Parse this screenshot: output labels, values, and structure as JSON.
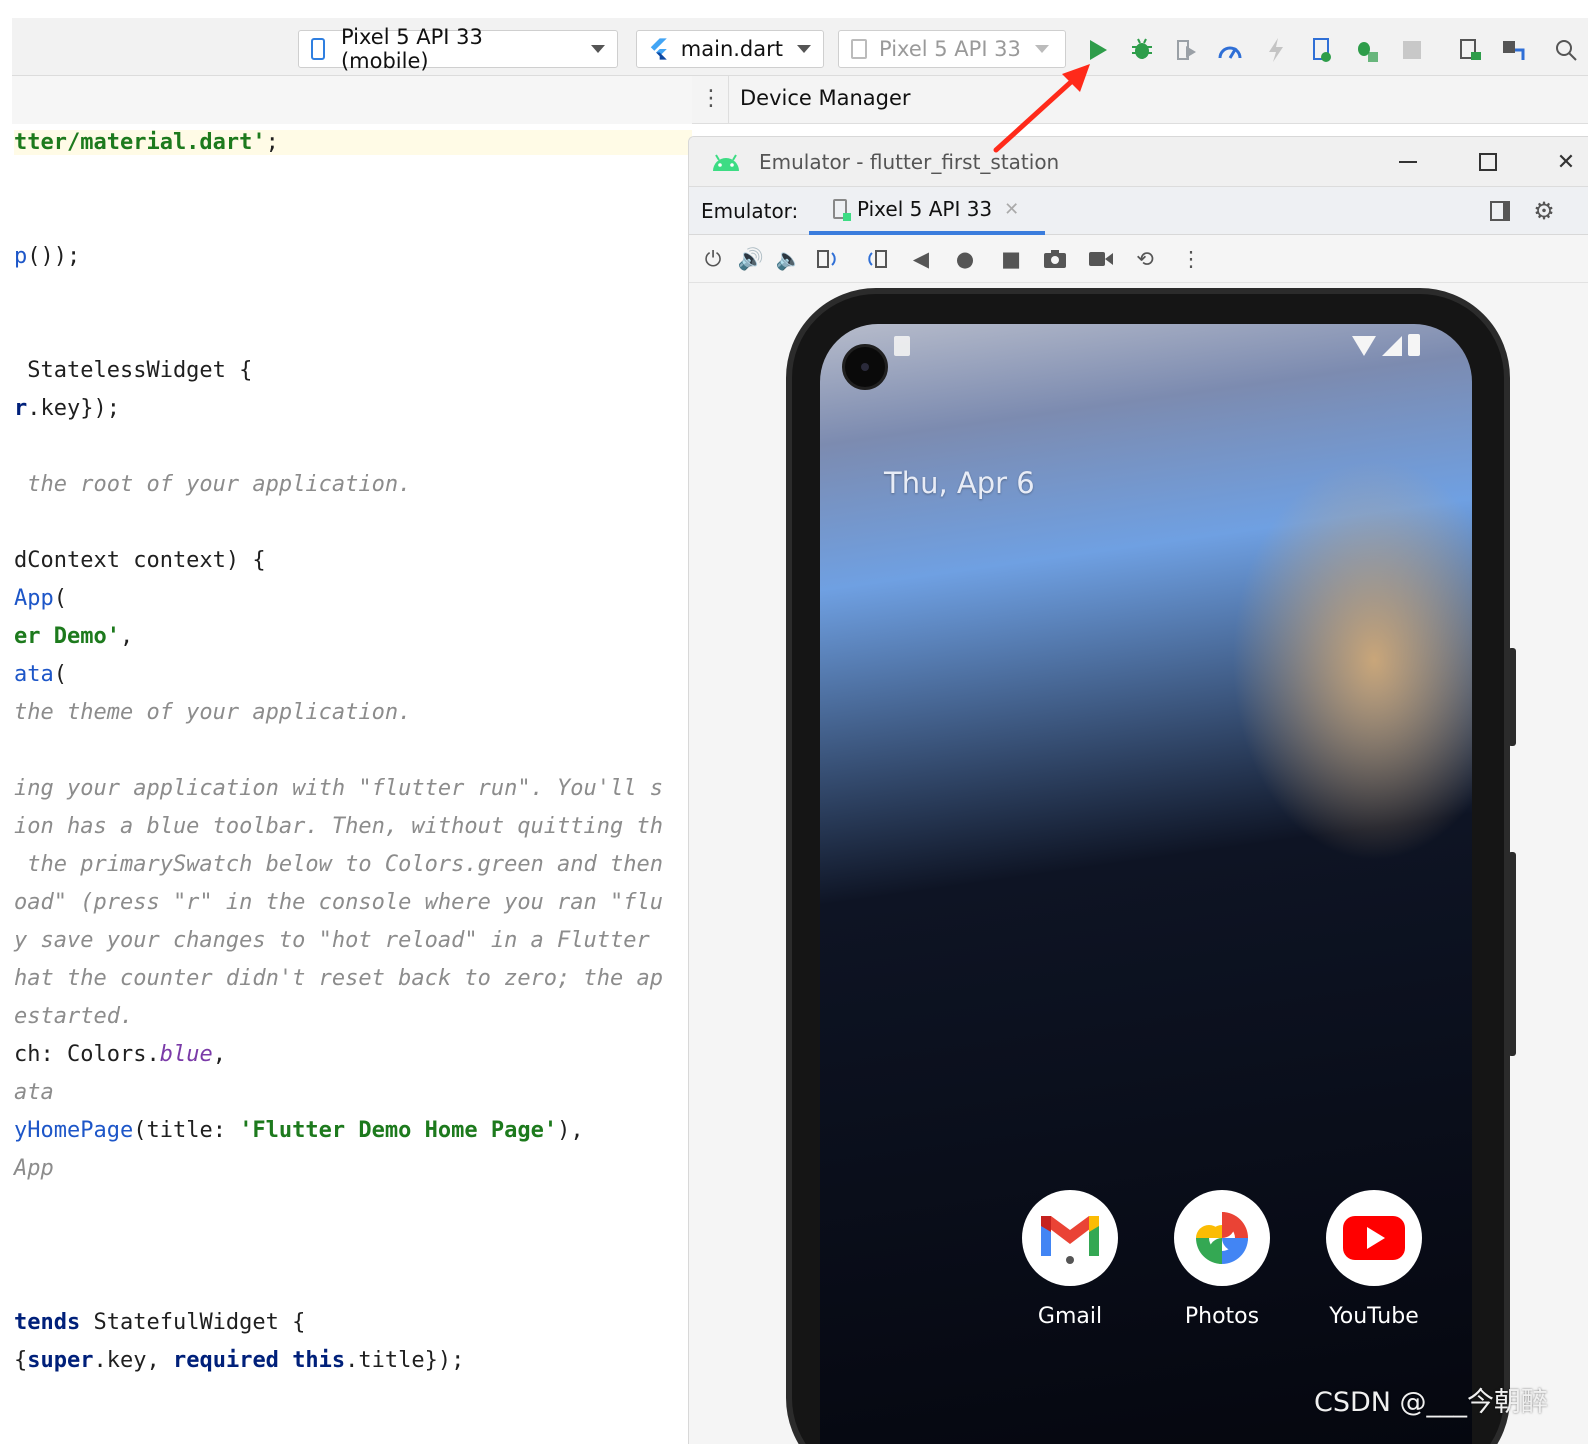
{
  "toolbar": {
    "device_selector": "Pixel 5 API 33 (mobile)",
    "run_config": "main.dart",
    "target_device": "Pixel 5 API 33",
    "icons": [
      "run-icon",
      "debug-icon",
      "run-with-coverage-icon",
      "profile-icon",
      "hot-reload-icon",
      "attach-debugger-icon",
      "debug-ext-icon",
      "stop-icon",
      "device-manager-icon",
      "sdk-manager-icon",
      "search-icon"
    ],
    "colors": {
      "run": "#2e9d4a",
      "debug": "#2e9d4a",
      "profile": "#2f6fd6"
    }
  },
  "tool_window": {
    "title": "Device Manager"
  },
  "editor": {
    "lines": [
      {
        "parts": [
          {
            "t": "tter/material.dart'",
            "c": "c-green"
          },
          {
            "t": ";",
            "c": ""
          }
        ],
        "highlight": true
      },
      {
        "parts": [
          {
            "t": "p",
            "c": "c-blue"
          },
          {
            "t": "());",
            "c": ""
          }
        ]
      },
      {
        "parts": [
          {
            "t": " StatelessWidget {",
            "c": ""
          }
        ]
      },
      {
        "parts": [
          {
            "t": "r",
            "c": "c-kw"
          },
          {
            "t": ".key});",
            "c": ""
          }
        ]
      },
      {
        "parts": [
          {
            "t": " the root of your application.",
            "c": "c-comment"
          }
        ]
      },
      {
        "parts": [
          {
            "t": "dContext context) {",
            "c": ""
          }
        ]
      },
      {
        "parts": [
          {
            "t": "App",
            "c": "c-blue"
          },
          {
            "t": "(",
            "c": ""
          }
        ]
      },
      {
        "parts": [
          {
            "t": "er Demo'",
            "c": "c-green"
          },
          {
            "t": ",",
            "c": ""
          }
        ]
      },
      {
        "parts": [
          {
            "t": "ata",
            "c": "c-blue"
          },
          {
            "t": "(",
            "c": ""
          }
        ]
      },
      {
        "parts": [
          {
            "t": "the theme of your application.",
            "c": "c-comment"
          }
        ]
      },
      {
        "parts": [
          {
            "t": "ing your application with \"flutter run\". You'll s",
            "c": "c-comment"
          }
        ]
      },
      {
        "parts": [
          {
            "t": "ion has a blue toolbar. Then, without quitting th",
            "c": "c-comment"
          }
        ]
      },
      {
        "parts": [
          {
            "t": " the primarySwatch below to Colors.green and then",
            "c": "c-comment"
          }
        ]
      },
      {
        "parts": [
          {
            "t": "oad\" (press \"r\" in the console where you ran \"flu",
            "c": "c-comment"
          }
        ]
      },
      {
        "parts": [
          {
            "t": "y save your changes to \"hot reload\" in a Flutter",
            "c": "c-comment"
          }
        ]
      },
      {
        "parts": [
          {
            "t": "hat the counter didn't reset back to zero; the ap",
            "c": "c-comment"
          }
        ]
      },
      {
        "parts": [
          {
            "t": "estarted.",
            "c": "c-comment"
          }
        ]
      },
      {
        "parts": [
          {
            "t": "ch: Colors.",
            "c": ""
          },
          {
            "t": "blue",
            "c": "c-purple"
          },
          {
            "t": ",",
            "c": ""
          }
        ]
      },
      {
        "parts": [
          {
            "t": "ata",
            "c": "c-comment"
          }
        ]
      },
      {
        "parts": [
          {
            "t": "yHomePage",
            "c": "c-blue"
          },
          {
            "t": "(title: ",
            "c": ""
          },
          {
            "t": "'Flutter Demo Home Page'",
            "c": "c-green"
          },
          {
            "t": "),",
            "c": ""
          }
        ]
      },
      {
        "parts": [
          {
            "t": "App",
            "c": "c-comment"
          }
        ]
      },
      {
        "parts": [
          {
            "t": "tends",
            "c": "c-kw"
          },
          {
            "t": " StatefulWidget {",
            "c": ""
          }
        ]
      },
      {
        "parts": [
          {
            "t": "{",
            "c": ""
          },
          {
            "t": "super",
            "c": "c-kw"
          },
          {
            "t": ".key, ",
            "c": ""
          },
          {
            "t": "required",
            "c": "c-kw"
          },
          {
            "t": " ",
            "c": ""
          },
          {
            "t": "this",
            "c": "c-kw"
          },
          {
            "t": ".title});",
            "c": ""
          }
        ]
      }
    ]
  },
  "emulator": {
    "window_title": "Emulator - flutter_first_station",
    "tabs_label": "Emulator:",
    "active_tab": "Pixel 5 API 33",
    "controls": [
      "power-icon",
      "volume-up-icon",
      "volume-down-icon",
      "rotate-left-icon",
      "rotate-right-icon",
      "back-icon",
      "home-icon",
      "overview-icon",
      "screenshot-icon",
      "screen-record-icon",
      "snapshot-icon",
      "more-icon"
    ]
  },
  "phone": {
    "date": "Thu, Apr 6",
    "apps": [
      {
        "label": "Gmail",
        "icon": "gmail-icon"
      },
      {
        "label": "Photos",
        "icon": "photos-icon"
      },
      {
        "label": "YouTube",
        "icon": "youtube-icon"
      }
    ]
  },
  "watermark": "CSDN @___今朝醉"
}
